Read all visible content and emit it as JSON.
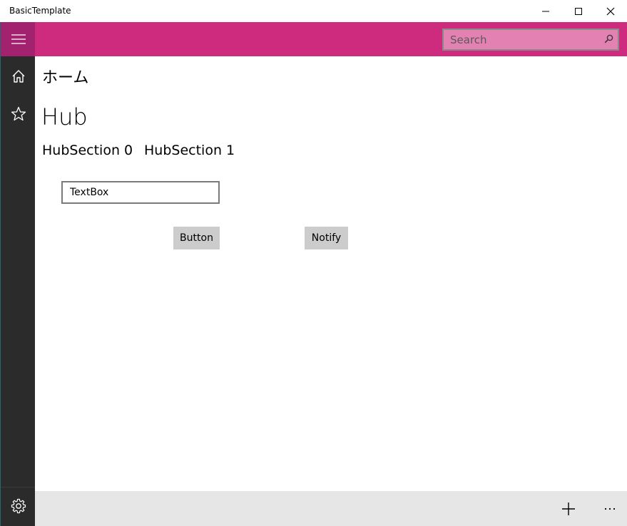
{
  "window": {
    "title": "BasicTemplate"
  },
  "topbar": {
    "accent_color": "#ce2a7e",
    "search_placeholder": "Search",
    "search_icon": "search-icon"
  },
  "rail": {
    "items": [
      {
        "icon": "hamburger-icon"
      },
      {
        "icon": "home-icon"
      },
      {
        "icon": "star-icon"
      },
      {
        "icon": "gear-icon"
      }
    ]
  },
  "main": {
    "page_header": "ホーム",
    "hub_title": "Hub",
    "hub_sections": [
      "HubSection 0",
      "HubSection 1"
    ],
    "textbox_value": "TextBox",
    "button_label": "Button",
    "notify_label": "Notify"
  },
  "commandbar": {
    "items": [
      {
        "icon": "add-icon"
      },
      {
        "icon": "more-icon"
      }
    ]
  }
}
